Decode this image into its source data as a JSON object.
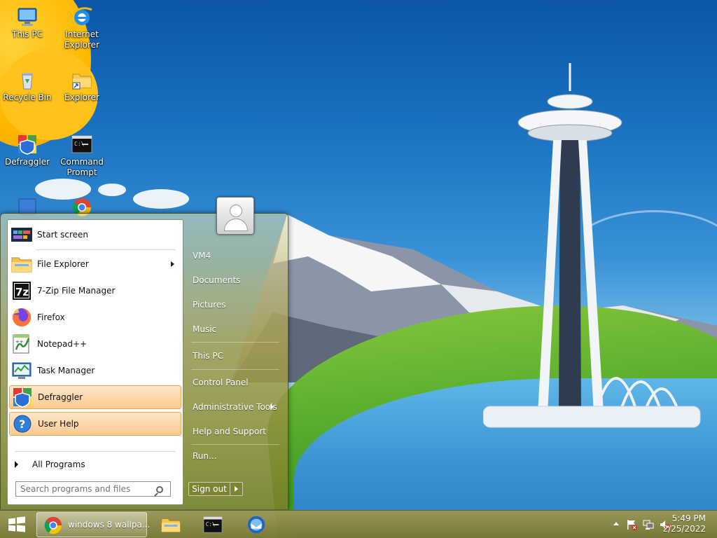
{
  "desktop": {
    "icons": [
      {
        "label": "This PC"
      },
      {
        "label": "Internet Explorer"
      },
      {
        "label": "Recycle Bin"
      },
      {
        "label": "Explorer"
      },
      {
        "label": "Defraggler"
      },
      {
        "label": "Command Prompt"
      }
    ]
  },
  "start_menu": {
    "pinned": [
      {
        "label": "Start screen",
        "icon": "start-screen-icon"
      },
      {
        "label": "File Explorer",
        "icon": "folder-icon",
        "submenu": true
      },
      {
        "label": "7-Zip File Manager",
        "icon": "7zip-icon",
        "icon_text": "7z"
      },
      {
        "label": "Firefox",
        "icon": "firefox-icon"
      },
      {
        "label": "Notepad++",
        "icon": "notepad-plus-plus-icon"
      },
      {
        "label": "Task Manager",
        "icon": "task-manager-icon"
      },
      {
        "label": "Defraggler",
        "icon": "defraggler-icon",
        "highlighted": true
      },
      {
        "label": "User Help",
        "icon": "help-icon",
        "highlighted": true
      }
    ],
    "all_programs_label": "All Programs",
    "search": {
      "placeholder": "Search programs and files"
    },
    "right": [
      {
        "label": "VM4"
      },
      {
        "label": "Documents"
      },
      {
        "label": "Pictures"
      },
      {
        "label": "Music"
      },
      {
        "label": "This PC"
      },
      {
        "label": "Control Panel"
      },
      {
        "label": "Administrative Tools",
        "submenu": true
      },
      {
        "label": "Help and Support"
      },
      {
        "label": "Run..."
      }
    ],
    "signout_label": "Sign out"
  },
  "taskbar": {
    "chrome_label": "windows 8 wallpa...",
    "clock": {
      "time": "5:49 PM",
      "date": "2/25/2022"
    }
  }
}
